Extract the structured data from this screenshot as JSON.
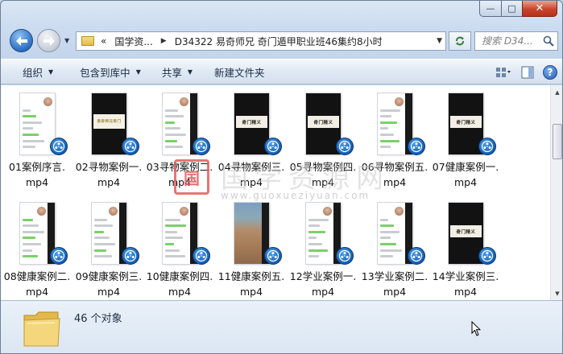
{
  "window": {
    "caption": {
      "minimize": "—",
      "maximize": "□",
      "close": "✕"
    }
  },
  "nav": {
    "back_icon": "arrow-left-icon",
    "forward_icon": "arrow-right-icon",
    "address": {
      "overflow": "«",
      "crumbs": [
        "国学资...",
        "D34322 易奇师兄 奇门遁甲职业班46集约8小时"
      ]
    },
    "search_placeholder": "搜索 D34..."
  },
  "toolbar": {
    "organize": "组织",
    "include_in_library": "包含到库中",
    "share": "共享",
    "new_folder": "新建文件夹",
    "help": "?"
  },
  "files": [
    {
      "line1": "01案例序言.",
      "line2": "mp4",
      "thumb": "chat"
    },
    {
      "line1": "02寻物案例一.",
      "line2": "mp4",
      "thumb": "dark-title"
    },
    {
      "line1": "03寻物案例二.",
      "line2": "mp4",
      "thumb": "chat-side"
    },
    {
      "line1": "04寻物案例三.",
      "line2": "mp4",
      "thumb": "dark-band"
    },
    {
      "line1": "05寻物案例四.",
      "line2": "mp4",
      "thumb": "dark-band"
    },
    {
      "line1": "06寻物案例五.",
      "line2": "mp4",
      "thumb": "chat-side"
    },
    {
      "line1": "07健康案例一.",
      "line2": "mp4",
      "thumb": "dark-band"
    },
    {
      "line1": "08健康案例二.",
      "line2": "mp4",
      "thumb": "chat-side"
    },
    {
      "line1": "09健康案例三.",
      "line2": "mp4",
      "thumb": "chat-side"
    },
    {
      "line1": "10健康案例四.",
      "line2": "mp4",
      "thumb": "chat-side"
    },
    {
      "line1": "11健康案例五.",
      "line2": "mp4",
      "thumb": "photo"
    },
    {
      "line1": "12学业案例一.",
      "line2": "mp4",
      "thumb": "chat-side"
    },
    {
      "line1": "13学业案例二.",
      "line2": "mp4",
      "thumb": "chat-side"
    },
    {
      "line1": "14学业案例三.",
      "line2": "mp4",
      "thumb": "dark-band"
    }
  ],
  "thumb_text": {
    "band": "奇门精义",
    "title": "易奇师兄奇门"
  },
  "watermark": {
    "logo": "国",
    "big": "国学资源网",
    "small": "www.guoxueziyuan.com"
  },
  "status": {
    "count": "46 个对象"
  },
  "colors": {
    "badge": "#1360b8",
    "close": "#c8452b",
    "chat_green": "#79d069"
  }
}
